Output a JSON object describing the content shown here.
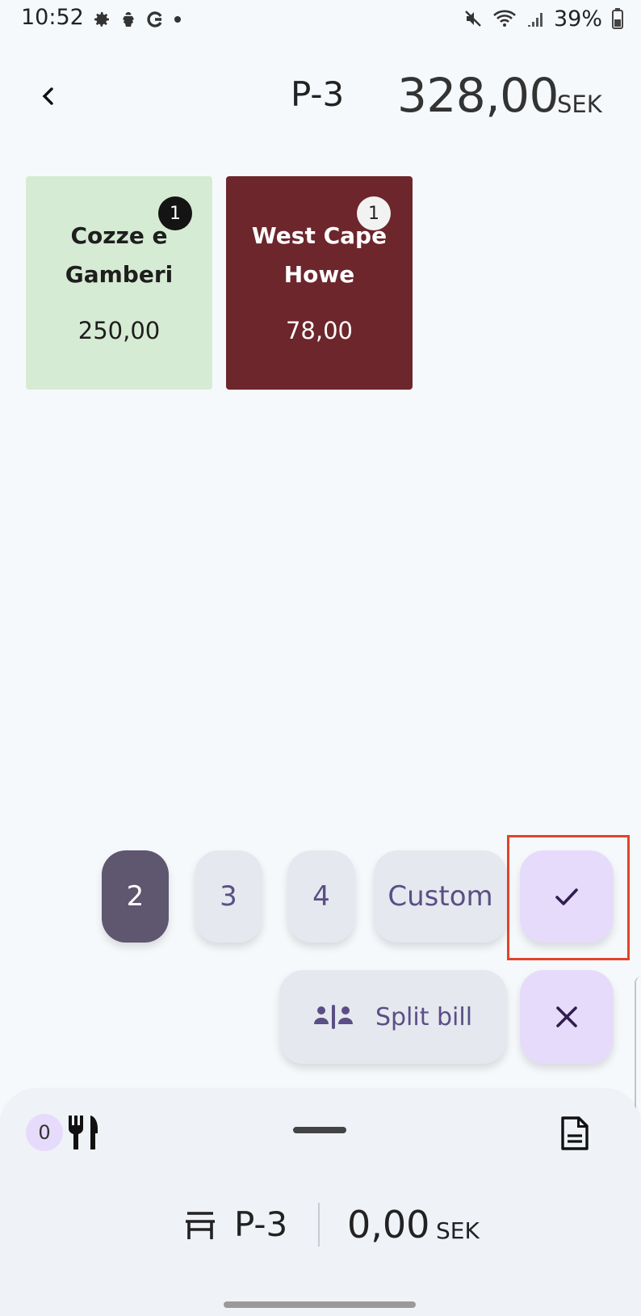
{
  "status_bar": {
    "time": "10:52",
    "battery": "39%",
    "icons": [
      "gear-icon",
      "bug-icon",
      "google-icon",
      "dot-icon",
      "mute-icon",
      "wifi-icon",
      "signal-icon",
      "battery-icon"
    ]
  },
  "header": {
    "table": "P-3",
    "total": "328,00",
    "currency": "SEK"
  },
  "products": [
    {
      "name_line1": "Cozze e",
      "name_line2": "Gamberi",
      "price": "250,00",
      "qty": "1",
      "bg": "#d6ebd3"
    },
    {
      "name_line1": "West Cape",
      "name_line2": "Howe",
      "price": "78,00",
      "qty": "1",
      "bg": "#6c262c"
    }
  ],
  "split_options": {
    "two": "2",
    "three": "3",
    "four": "4",
    "custom": "Custom",
    "selected": "2"
  },
  "actions": {
    "split_bill": "Split bill"
  },
  "bottom_sheet": {
    "counter": "0",
    "table": "P-3",
    "amount": "0,00",
    "currency": "SEK"
  },
  "colors": {
    "accent": "#e7dbfb",
    "selected_chip": "#5f566f",
    "highlight": "#e2432a"
  }
}
